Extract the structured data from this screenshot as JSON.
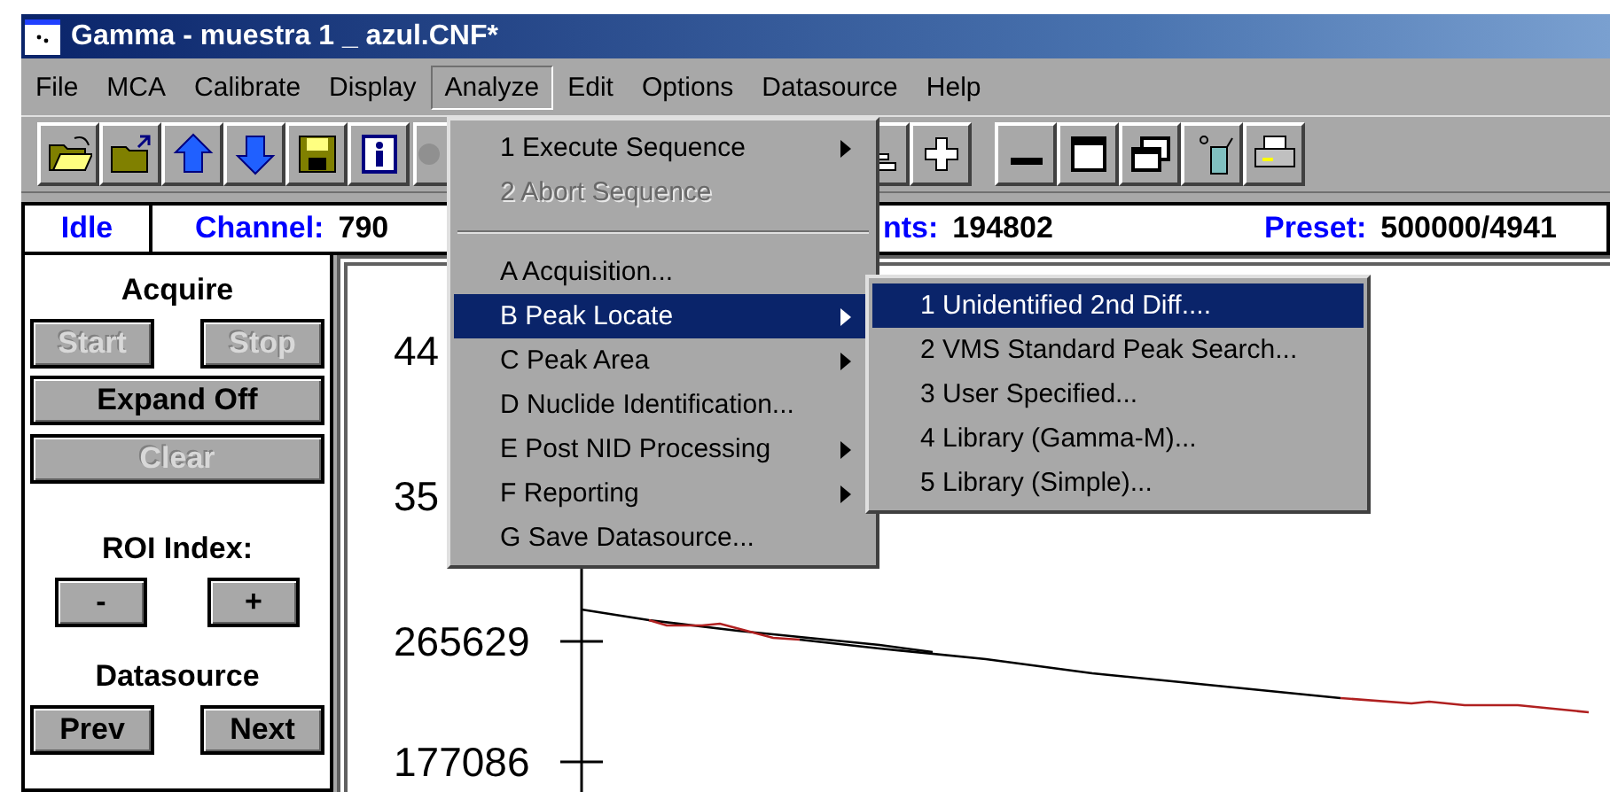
{
  "window": {
    "title": "Gamma - muestra 1 _ azul.CNF*"
  },
  "menu_bar": [
    {
      "label": "File",
      "selected": false
    },
    {
      "label": "MCA",
      "selected": false
    },
    {
      "label": "Calibrate",
      "selected": false
    },
    {
      "label": "Display",
      "selected": false
    },
    {
      "label": "Analyze",
      "selected": true
    },
    {
      "label": "Edit",
      "selected": false
    },
    {
      "label": "Options",
      "selected": false
    },
    {
      "label": "Datasource",
      "selected": false
    },
    {
      "label": "Help",
      "selected": false
    }
  ],
  "status_bar": {
    "state": "Idle",
    "channel_label": "Channel:",
    "channel_value": "790",
    "counts_label": "nts:",
    "counts_value": "194802",
    "preset_label": "Preset:",
    "preset_value": "500000/4941"
  },
  "control_panel": {
    "acquire_title": "Acquire",
    "acquire_buttons": [
      {
        "label": "Start",
        "disabled": true
      },
      {
        "label": "Stop",
        "disabled": true
      }
    ],
    "expand_button": {
      "label": "Expand Off",
      "disabled": false
    },
    "clear_button": {
      "label": "Clear",
      "disabled": true
    },
    "roi_title": "ROI Index:",
    "roi_buttons": [
      {
        "label": "-",
        "disabled": false
      },
      {
        "label": "+",
        "disabled": false
      }
    ],
    "datasource_title": "Datasource",
    "datasource_buttons": [
      {
        "label": "Prev",
        "disabled": false
      },
      {
        "label": "Next",
        "disabled": false
      }
    ]
  },
  "plot": {
    "y_tick_labels": [
      "44",
      "35",
      "265629",
      "177086"
    ]
  },
  "analyze_menu": [
    {
      "label": "1 Execute Sequence",
      "kind": "item",
      "submenu": true,
      "disabled": false,
      "selected": false
    },
    {
      "label": "2 Abort Sequence",
      "kind": "item",
      "submenu": false,
      "disabled": true,
      "selected": false
    },
    {
      "kind": "separator"
    },
    {
      "label": "A Acquisition...",
      "kind": "item",
      "submenu": false,
      "disabled": false,
      "selected": false
    },
    {
      "label": "B Peak Locate",
      "kind": "item",
      "submenu": true,
      "disabled": false,
      "selected": true
    },
    {
      "label": "C Peak Area",
      "kind": "item",
      "submenu": true,
      "disabled": false,
      "selected": false
    },
    {
      "label": "D Nuclide Identification...",
      "kind": "item",
      "submenu": false,
      "disabled": false,
      "selected": false
    },
    {
      "label": "E Post NID Processing",
      "kind": "item",
      "submenu": true,
      "disabled": false,
      "selected": false
    },
    {
      "label": "F Reporting",
      "kind": "item",
      "submenu": true,
      "disabled": false,
      "selected": false
    },
    {
      "label": "G Save Datasource...",
      "kind": "item",
      "submenu": false,
      "disabled": false,
      "selected": false
    }
  ],
  "peak_locate_submenu": [
    {
      "label": "1 Unidentified 2nd Diff....",
      "selected": true
    },
    {
      "label": "2 VMS Standard Peak Search...",
      "selected": false
    },
    {
      "label": "3 User Specified...",
      "selected": false
    },
    {
      "label": "4 Library (Gamma-M)...",
      "selected": false
    },
    {
      "label": "5 Library (Simple)...",
      "selected": false
    }
  ]
}
